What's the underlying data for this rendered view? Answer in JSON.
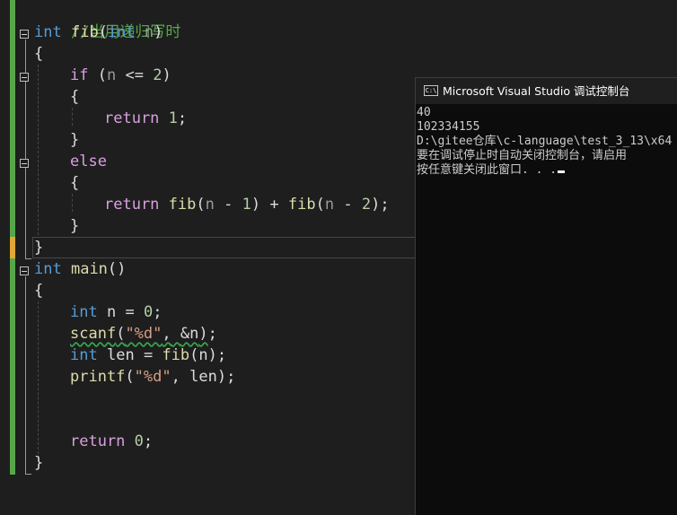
{
  "editor": {
    "comment": "//当用递归写时",
    "fib_sig": {
      "kw1": "int",
      "fn": "fib",
      "open": "(",
      "kw2": "int",
      "param": "n",
      "close": ")"
    },
    "brace_open": "{",
    "brace_close": "}",
    "if_line": {
      "kw": "if",
      "open": "(",
      "param": "n",
      "op": "<=",
      "num": "2",
      "close": ")"
    },
    "return1": {
      "kw": "return",
      "num": "1",
      "end": ";"
    },
    "else_kw": "else",
    "return2": {
      "kw": "return",
      "fn1": "fib",
      "o1": "(",
      "p1": "n",
      "minus1": "-",
      "n1": "1",
      "c1": ")",
      "plus": "+",
      "fn2": "fib",
      "o2": "(",
      "p2": "n",
      "minus2": "-",
      "n2": "2",
      "c2": ")",
      "end": ";"
    },
    "main_sig": {
      "kw": "int",
      "fn": "main",
      "parens": "()"
    },
    "decl_n": {
      "kw": "int",
      "var": "n",
      "eq": "=",
      "num": "0",
      "end": ";"
    },
    "scanf_line": {
      "fn": "scanf",
      "open": "(",
      "fmt": "\"%d\"",
      "comma": ",",
      "arg": "&n",
      "close": ")",
      "end": ";"
    },
    "len_line": {
      "kw": "int",
      "var": "len",
      "eq": "=",
      "fn": "fib",
      "open": "(",
      "arg": "n",
      "close": ")",
      "end": ";"
    },
    "printf_line": {
      "fn": "printf",
      "open": "(",
      "fmt": "\"%d\"",
      "comma": ",",
      "arg": "len",
      "close": ")",
      "end": ";"
    },
    "return0": {
      "kw": "return",
      "num": "0",
      "end": ";"
    }
  },
  "console": {
    "title": "Microsoft Visual Studio 调试控制台",
    "icon_text": "C:\\",
    "lines": [
      "40",
      "102334155",
      "D:\\gitee仓库\\c-language\\test_3_13\\x64",
      "要在调试停止时自动关闭控制台，请启用",
      "按任意键关闭此窗口. . ."
    ]
  },
  "colors": {
    "background": "#1e1e1e",
    "keyword": "#569cd6",
    "function": "#dcdcaa",
    "control": "#d8a0df",
    "number": "#b5cea8",
    "string": "#d69d85",
    "comment": "#57a64a",
    "change_saved": "#57a64a",
    "change_unsaved": "#e2a634"
  }
}
